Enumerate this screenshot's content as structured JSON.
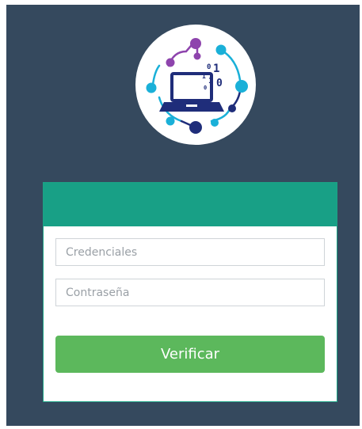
{
  "login": {
    "username_placeholder": "Credenciales",
    "username_value": "",
    "password_placeholder": "Contraseña",
    "password_value": "",
    "submit_label": "Verificar"
  },
  "logo": {
    "icon": "laptop-network-logo-icon",
    "binary_digits": [
      "0",
      "1",
      "1",
      "0",
      "1",
      "0"
    ]
  },
  "colors": {
    "background": "#35495e",
    "card_header": "#18a086",
    "button": "#5cb85c",
    "logo_purple": "#8e44ad",
    "logo_cyan": "#1ab0d8",
    "logo_navy": "#1f2d7a"
  }
}
